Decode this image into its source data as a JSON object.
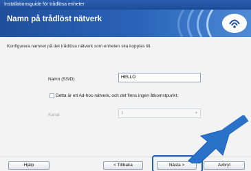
{
  "window": {
    "title": "Installationsguide för trådlösa enheter"
  },
  "header": {
    "title": "Namn på trådlöst nätverk"
  },
  "description": "Konfigurera namnet på det trådlösa nätverk som enheten ska kopplas till.",
  "form": {
    "ssid_label": "Namn (SSID)",
    "ssid_value": "HELLO",
    "adhoc_label": "Detta är ett Ad-hoc-nätverk, och det finns ingen åtkomstpunkt.",
    "adhoc_checked": false,
    "channel_label": "Kanal",
    "channel_value": "1"
  },
  "buttons": {
    "help": "Hjälp",
    "back": "< Tillbaka",
    "next": "Nästa >",
    "cancel": "Avbryt"
  },
  "colors": {
    "header": "#1f4f9c",
    "highlight": "#1c5fbf",
    "arrow": "#2a72c8"
  },
  "icons": {
    "wifi": "wifi-signal-icon",
    "arrow": "pointer-arrow-icon"
  }
}
